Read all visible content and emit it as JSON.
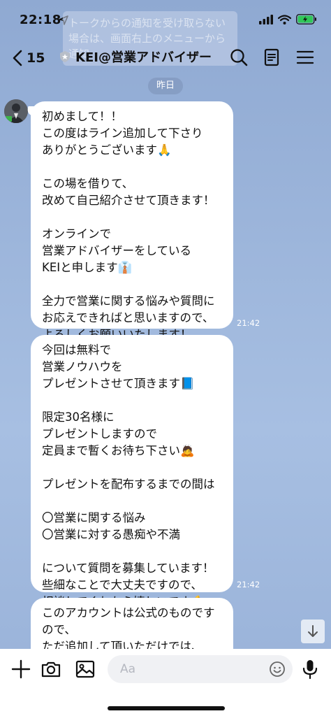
{
  "status_bar": {
    "time": "22:18",
    "icons": [
      "location-arrow-icon",
      "cellular-signal-icon",
      "wifi-icon",
      "battery-charging-icon"
    ]
  },
  "notice_overlay": {
    "text": "トークからの通知を受け取らない場合は、画面右上のメニューから通知"
  },
  "header": {
    "back_count": "15",
    "title": "KEI@営業アドバイザー",
    "icons": [
      "back-chevron-icon",
      "shield-badge-icon",
      "search-icon",
      "notes-icon",
      "menu-icon"
    ]
  },
  "date_separator": "昨日",
  "messages": [
    {
      "sender": "KEI@営業アドバイザー",
      "text": "初めまして！！\nこの度はライン追加して下さり\nありがとうございます🙏\n\nこの場を借りて、\n改めて自己紹介させて頂きます！\n\nオンラインで\n営業アドバイザーをしている\nKEIと申します👔\n\n全力で営業に関する悩みや質問に\nお応えできればと思いますので、\nよろしくお願いいたします！",
      "time": "21:42"
    },
    {
      "sender": "KEI@営業アドバイザー",
      "text": "今回は無料で\n営業ノウハウを\nプレゼントさせて頂きます📘\n\n限定30名様に\nプレゼントしますので\n定員まで暫くお待ち下さい🙇\n\nプレゼントを配布するまでの間は\n\n〇営業に関する悩み\n〇営業に対する愚痴や不満\n\nについて質問を募集しています！\n些細なことで大丈夫ですので、\n相談してくれたら嬉しいです💪",
      "time": "21:42"
    },
    {
      "sender": "KEI@営業アドバイザー",
      "text": "このアカウントは公式のものですので、\nただ追加して頂いただけでは、",
      "time": ""
    }
  ],
  "input_bar": {
    "placeholder": "Aa",
    "icons": [
      "plus-icon",
      "camera-icon",
      "image-icon",
      "emoji-icon",
      "microphone-icon"
    ]
  },
  "colors": {
    "background": "#9bb4da",
    "bubble": "#ffffff",
    "date_pill": "#8298be"
  }
}
